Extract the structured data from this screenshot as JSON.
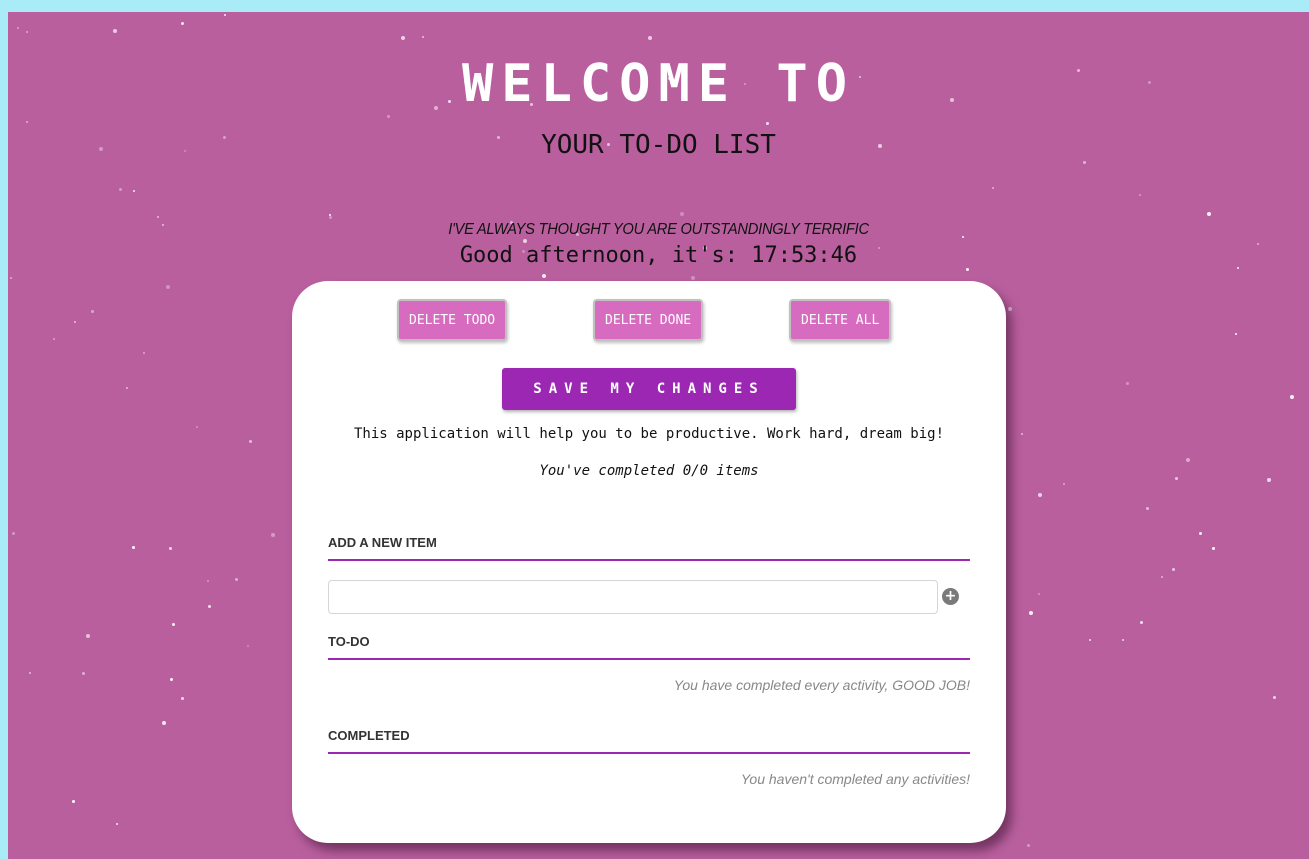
{
  "header": {
    "title": "WELCOME TO",
    "subtitle": "YOUR TO-DO LIST",
    "compliment": "I'VE ALWAYS THOUGHT YOU ARE OUTSTANDINGLY TERRIFIC",
    "greeting": "Good afternoon, it's: 17:53:46"
  },
  "actions": {
    "delete_todo_label": "DELETE TODO",
    "delete_done_label": "DELETE DONE",
    "delete_all_label": "DELETE ALL",
    "save_label": "SAVE MY CHANGES"
  },
  "info": {
    "description": "This application will help you to be productive. Work hard, dream big!",
    "progress_text": "You've completed 0/0 items"
  },
  "add_item": {
    "heading": "ADD A NEW ITEM",
    "input_value": "",
    "add_icon": "plus-circle-icon"
  },
  "todo": {
    "heading": "TO-DO",
    "empty_message": "You have completed every activity, GOOD JOB!"
  },
  "completed": {
    "heading": "COMPLETED",
    "empty_message": "You haven't completed any activities!"
  },
  "colors": {
    "page_border": "#a9ecf7",
    "background": "#b95f9e",
    "accent": "#9b27b3",
    "delete_button": "#d66bbf"
  }
}
